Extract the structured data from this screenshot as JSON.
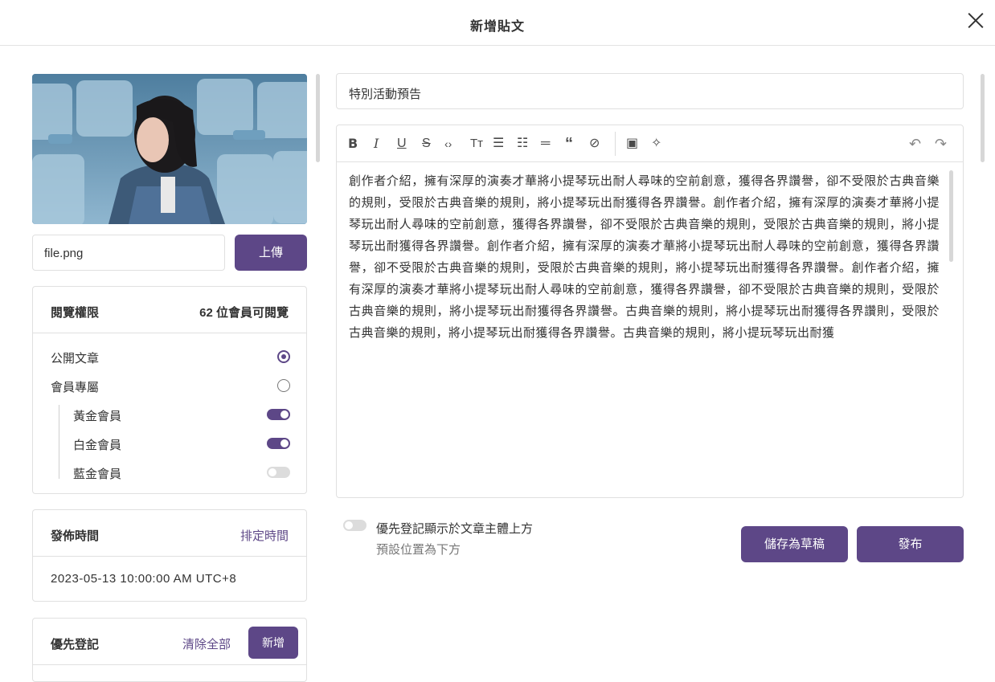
{
  "modal": {
    "title": "新增貼文"
  },
  "upload": {
    "file_name": "file.png",
    "upload_label": "上傳"
  },
  "permissions": {
    "title": "閱覽權限",
    "summary": "62 位會員可閱覽",
    "options": [
      {
        "label": "公開文章",
        "selected": true
      },
      {
        "label": "會員專屬",
        "selected": false
      }
    ],
    "tiers": [
      {
        "label": "黃金會員",
        "enabled": true
      },
      {
        "label": "白金會員",
        "enabled": true
      },
      {
        "label": "藍金會員",
        "enabled": false
      }
    ]
  },
  "publish_time": {
    "title": "發佈時間",
    "schedule_label": "排定時間",
    "value": "2023-05-13 10:00:00 AM UTC+8"
  },
  "priority": {
    "title": "優先登記",
    "clear_label": "清除全部",
    "add_label": "新增",
    "toggle_label": "優先登記顯示於文章主體上方",
    "toggle_hint": "預設位置為下方",
    "toggle_on": false
  },
  "post": {
    "subject": "特別活動預告",
    "body": "創作者介紹，擁有深厚的演奏才華將小提琴玩出耐人尋味的空前創意，獲得各界讚譽，卻不受限於古典音樂的規則，受限於古典音樂的規則，將小提琴玩出耐獲得各界讚譽。創作者介紹，擁有深厚的演奏才華將小提琴玩出耐人尋味的空前創意，獲得各界讚譽，卻不受限於古典音樂的規則，受限於古典音樂的規則，將小提琴玩出耐獲得各界讚譽。創作者介紹，擁有深厚的演奏才華將小提琴玩出耐人尋味的空前創意，獲得各界讚譽，卻不受限於古典音樂的規則，受限於古典音樂的規則，將小提琴玩出耐獲得各界讚譽。創作者介紹，擁有深厚的演奏才華將小提琴玩出耐人尋味的空前創意，獲得各界讚譽，卻不受限於古典音樂的規則，受限於古典音樂的規則，將小提琴玩出耐獲得各界讚譽。古典音樂的規則，將小提琴玩出耐獲得各界讚則，受限於古典音樂的規則，將小提琴玩出耐獲得各界讚譽。古典音樂的規則，將小提玩琴玩出耐獲"
  },
  "toolbar": {
    "icons": [
      "bold-icon",
      "italic-icon",
      "underline-icon",
      "strikethrough-icon",
      "code-icon",
      "text-size-icon",
      "bullet-list-icon",
      "numbered-list-icon",
      "divider-icon",
      "quote-icon",
      "link-icon",
      "image-icon",
      "magic-icon",
      "undo-icon",
      "redo-icon"
    ]
  },
  "actions": {
    "draft_label": "儲存為草稿",
    "publish_label": "發布"
  },
  "colors": {
    "accent": "#5d4787",
    "border": "#e0e0e0"
  }
}
